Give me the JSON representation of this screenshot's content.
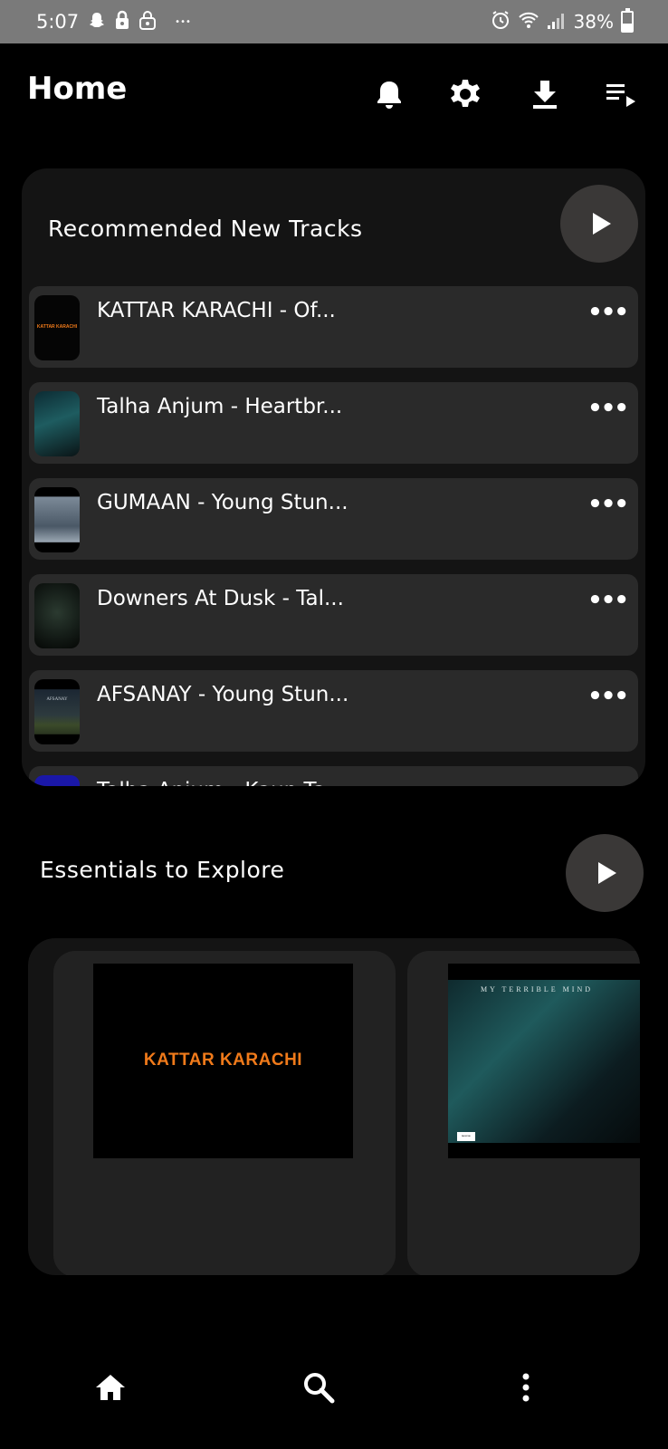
{
  "status_bar": {
    "time": "5:07",
    "battery": "38%",
    "battery_level": 0.38,
    "left_icons": [
      "snapchat-icon",
      "lock-icon",
      "padlock-open-icon",
      "more-notifications-icon"
    ],
    "right_icons": [
      "alarm-icon",
      "wifi-icon",
      "signal-icon",
      "battery-icon"
    ]
  },
  "header": {
    "title": "Home",
    "icons": [
      "bell-icon",
      "gear-icon",
      "download-icon",
      "queue-icon"
    ]
  },
  "recommended": {
    "title": "Recommended New Tracks",
    "tracks": [
      {
        "title": "KATTAR KARACHI - Of...",
        "thumb_text": "KATTAR KARACHI"
      },
      {
        "title": "Talha Anjum - Heartbr..."
      },
      {
        "title": "GUMAAN - Young Stun..."
      },
      {
        "title": "Downers At Dusk - Tal..."
      },
      {
        "title": "AFSANAY - Young Stun...",
        "thumb_text": "AFSANAY"
      },
      {
        "title": "Talha Anjum - Kaun Ta..."
      }
    ]
  },
  "essentials": {
    "title": "Essentials to Explore",
    "cards": [
      {
        "art_text": "KATTAR KARACHI"
      },
      {
        "art_text": "MY TERRIBLE MIND",
        "badge": "PARENTAL ADVISORY"
      }
    ]
  },
  "bottom_nav": {
    "items": [
      "home-icon",
      "search-icon",
      "more-vertical-icon"
    ]
  },
  "colors": {
    "background": "#000000",
    "status_bar": "#7a7a7a",
    "card": "#141414",
    "track_row": "#2a2a2a",
    "play_button": "#3a3837",
    "accent_orange": "#f07a1a"
  }
}
